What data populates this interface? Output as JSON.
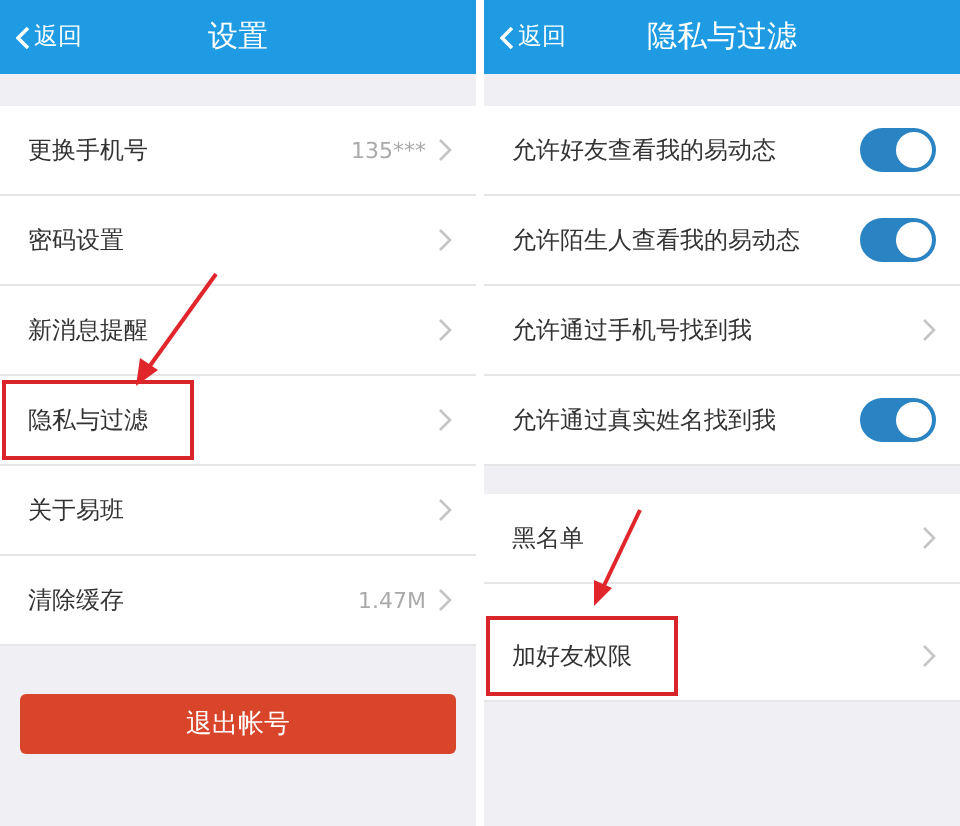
{
  "screens": [
    {
      "back": "返回",
      "title": "设置",
      "rows": [
        {
          "kind": "link",
          "label": "更换手机号",
          "value": "135***",
          "highlighted": false
        },
        {
          "kind": "link",
          "label": "密码设置",
          "highlighted": false
        },
        {
          "kind": "link",
          "label": "新消息提醒",
          "highlighted": false
        },
        {
          "kind": "link",
          "label": "隐私与过滤",
          "highlighted": true
        },
        {
          "kind": "link",
          "label": "关于易班",
          "highlighted": false
        },
        {
          "kind": "link",
          "label": "清除缓存",
          "value": "1.47M",
          "highlighted": false
        }
      ],
      "button": "退出帐号"
    },
    {
      "back": "返回",
      "title": "隐私与过滤",
      "rows": [
        {
          "kind": "toggle",
          "label": "允许好友查看我的易动态",
          "on": true
        },
        {
          "kind": "toggle",
          "label": "允许陌生人查看我的易动态",
          "on": true
        },
        {
          "kind": "link",
          "label": "允许通过手机号找到我",
          "highlighted": false
        },
        {
          "kind": "toggle",
          "label": "允许通过真实姓名找到我",
          "on": true
        },
        {
          "kind": "link",
          "label": "黑名单",
          "highlighted": false
        },
        {
          "kind": "link",
          "label": "加好友权限",
          "highlighted": true
        }
      ]
    }
  ]
}
